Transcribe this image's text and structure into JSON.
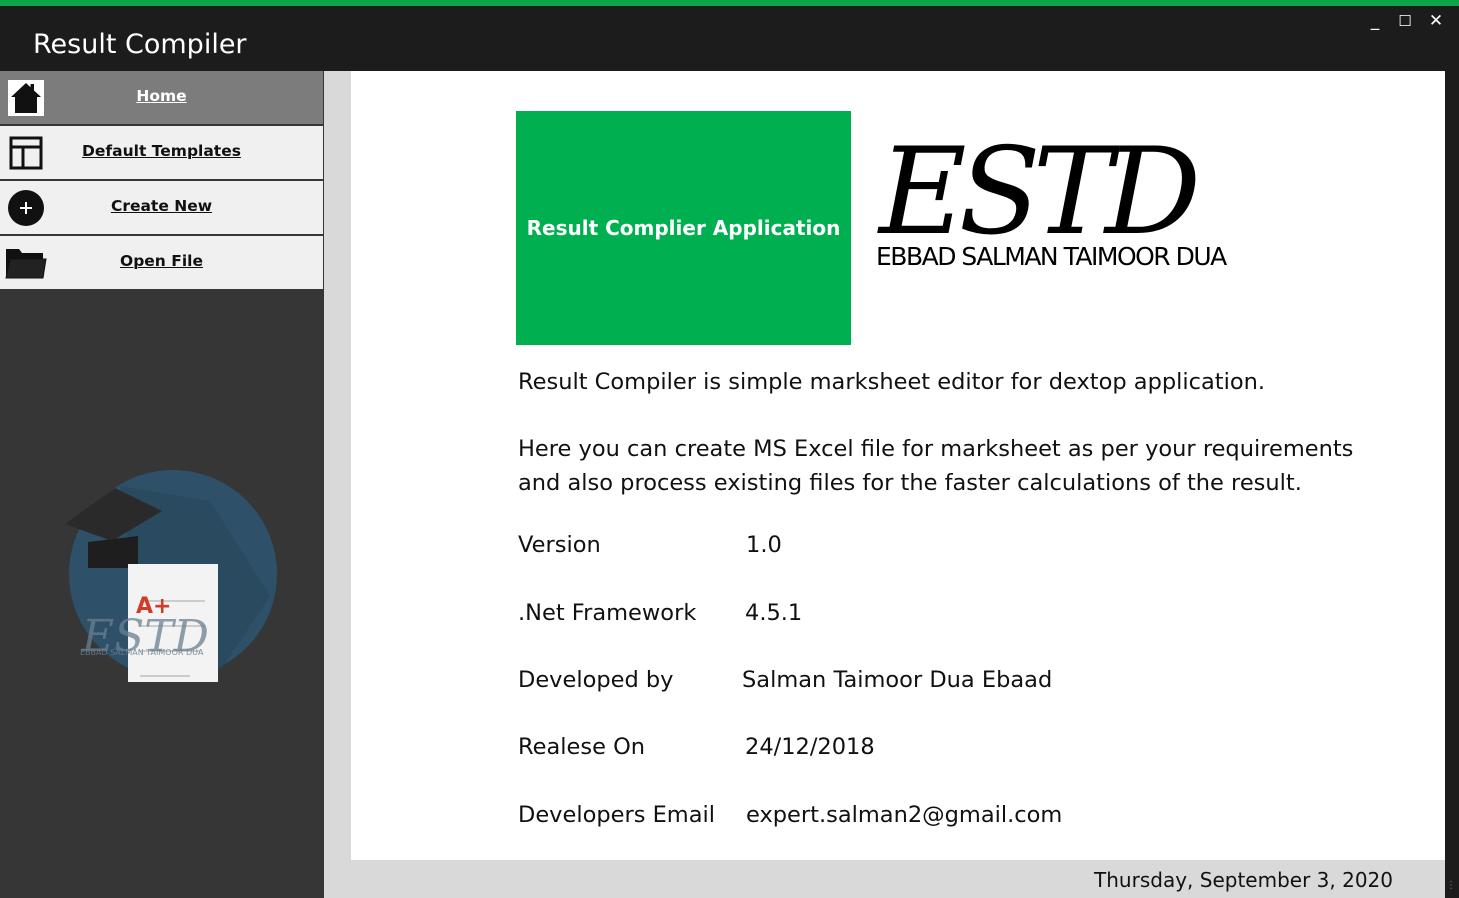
{
  "window": {
    "title": "Result Compiler",
    "controls": {
      "minimize": "_",
      "maximize": "☐",
      "close": "✕"
    }
  },
  "sidebar": {
    "items": [
      {
        "label": "Home",
        "icon": "home-icon",
        "active": true
      },
      {
        "label": "Default Templates",
        "icon": "template-icon",
        "active": false
      },
      {
        "label": "Create New",
        "icon": "plus-circle-icon",
        "active": false
      },
      {
        "label": "Open File",
        "icon": "folder-icon",
        "active": false
      }
    ],
    "logo": {
      "grade": "A+",
      "monogram": "ESTD",
      "caption": "EBBAD SALMAN TAIMOOR DUA"
    }
  },
  "main": {
    "banner": "Result Complier Application",
    "brand": {
      "monogram": "ESTD",
      "caption": "EBBAD SALMAN  TAIMOOR DUA"
    },
    "description_1": "Result Compiler is simple marksheet editor for dextop application.",
    "description_2": "Here you can create MS Excel file for marksheet as per your requirements and also process existing files for the faster calculations of the result.",
    "info": [
      {
        "label": "Version",
        "value": "1.0"
      },
      {
        "label": ".Net Framework",
        "value": "4.5.1"
      },
      {
        "label": "Developed by",
        "value": "Salman Taimoor Dua Ebaad"
      },
      {
        "label": "Realese On",
        "value": "24/12/2018"
      },
      {
        "label": "Developers Email",
        "value": "expert.salman2@gmail.com"
      }
    ]
  },
  "status_bar": {
    "date": "Thursday, September 3, 2020"
  },
  "colors": {
    "accent": "#0fa64a",
    "banner": "#00b050",
    "sidebar": "#363636",
    "titlebar": "#1c1c1c"
  }
}
